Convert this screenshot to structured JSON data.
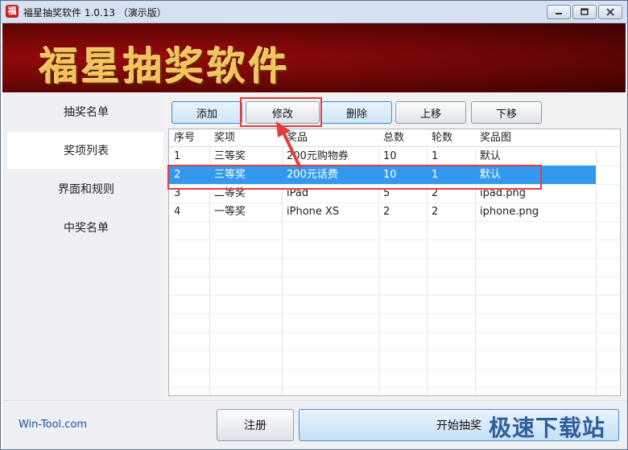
{
  "window": {
    "title": "福星抽奖软件 1.0.13 （演示版）",
    "app_icon_glyph": "福",
    "controls": [
      "minimize-icon",
      "maximize-icon",
      "close-icon"
    ]
  },
  "banner": {
    "title": "福星抽奖软件"
  },
  "sidebar": {
    "items": [
      {
        "label": "抽奖名单",
        "active": false
      },
      {
        "label": "奖项列表",
        "active": true
      },
      {
        "label": "界面和规则",
        "active": false
      },
      {
        "label": "中奖名单",
        "active": false
      }
    ]
  },
  "toolbar": {
    "add_label": "添加",
    "edit_label": "修改",
    "delete_label": "删除",
    "up_label": "上移",
    "down_label": "下移"
  },
  "table": {
    "headers": [
      "序号",
      "奖项",
      "奖品",
      "总数",
      "轮数",
      "奖品图"
    ],
    "rows": [
      [
        "1",
        "三等奖",
        "200元购物券",
        "10",
        "1",
        "默认"
      ],
      [
        "2",
        "三等奖",
        "200元话费",
        "10",
        "1",
        "默认"
      ],
      [
        "3",
        "二等奖",
        "iPad",
        "5",
        "2",
        "ipad.png"
      ],
      [
        "4",
        "一等奖",
        "iPhone XS",
        "2",
        "2",
        "iphone.png"
      ]
    ],
    "selected_row": 2
  },
  "footer": {
    "site": "Win-Tool.com",
    "register_label": "注册",
    "start_label": "开始抽奖",
    "watermark": "极速下载站"
  },
  "colors": {
    "selection": "#3399ee",
    "annotation": "#e53d3d",
    "banner_text": "#f3c25c",
    "banner_bg": "#6b0606"
  }
}
